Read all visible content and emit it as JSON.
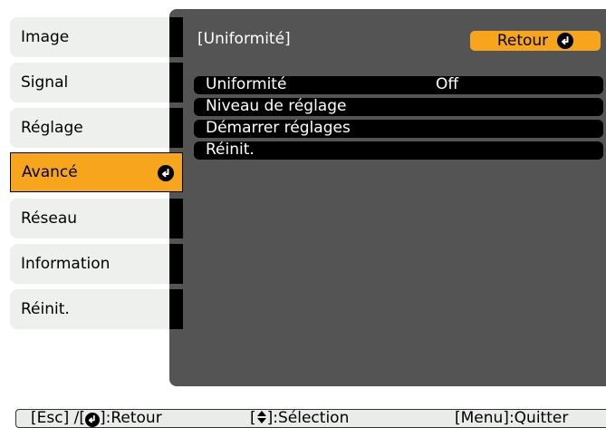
{
  "sidebar": {
    "items": [
      {
        "label": "Image"
      },
      {
        "label": "Signal"
      },
      {
        "label": "Réglage"
      },
      {
        "label": "Avancé"
      },
      {
        "label": "Réseau"
      },
      {
        "label": "Information"
      },
      {
        "label": "Réinit."
      }
    ],
    "active": "Avancé"
  },
  "panel": {
    "title": "[Uniformité]",
    "back_label": "Retour"
  },
  "menu": {
    "items": [
      {
        "label": "Uniformité",
        "value": "Off"
      },
      {
        "label": "Niveau de réglage",
        "value": ""
      },
      {
        "label": "Démarrer réglages",
        "value": ""
      },
      {
        "label": "Réinit.",
        "value": ""
      }
    ]
  },
  "statusbar": {
    "back_hint_prefix": "[Esc] /[",
    "back_hint_suffix": "]:Retour",
    "select_hint_prefix": "[",
    "select_hint_suffix": "]:Sélection",
    "quit_hint": "[Menu]:Quitter"
  },
  "colors": {
    "accent": "#f7a51c",
    "panel": "#545454",
    "sidebar_item": "#eef0ee",
    "row": "#000000"
  },
  "icons": [
    "enter-icon",
    "up-down-arrow-icon"
  ]
}
